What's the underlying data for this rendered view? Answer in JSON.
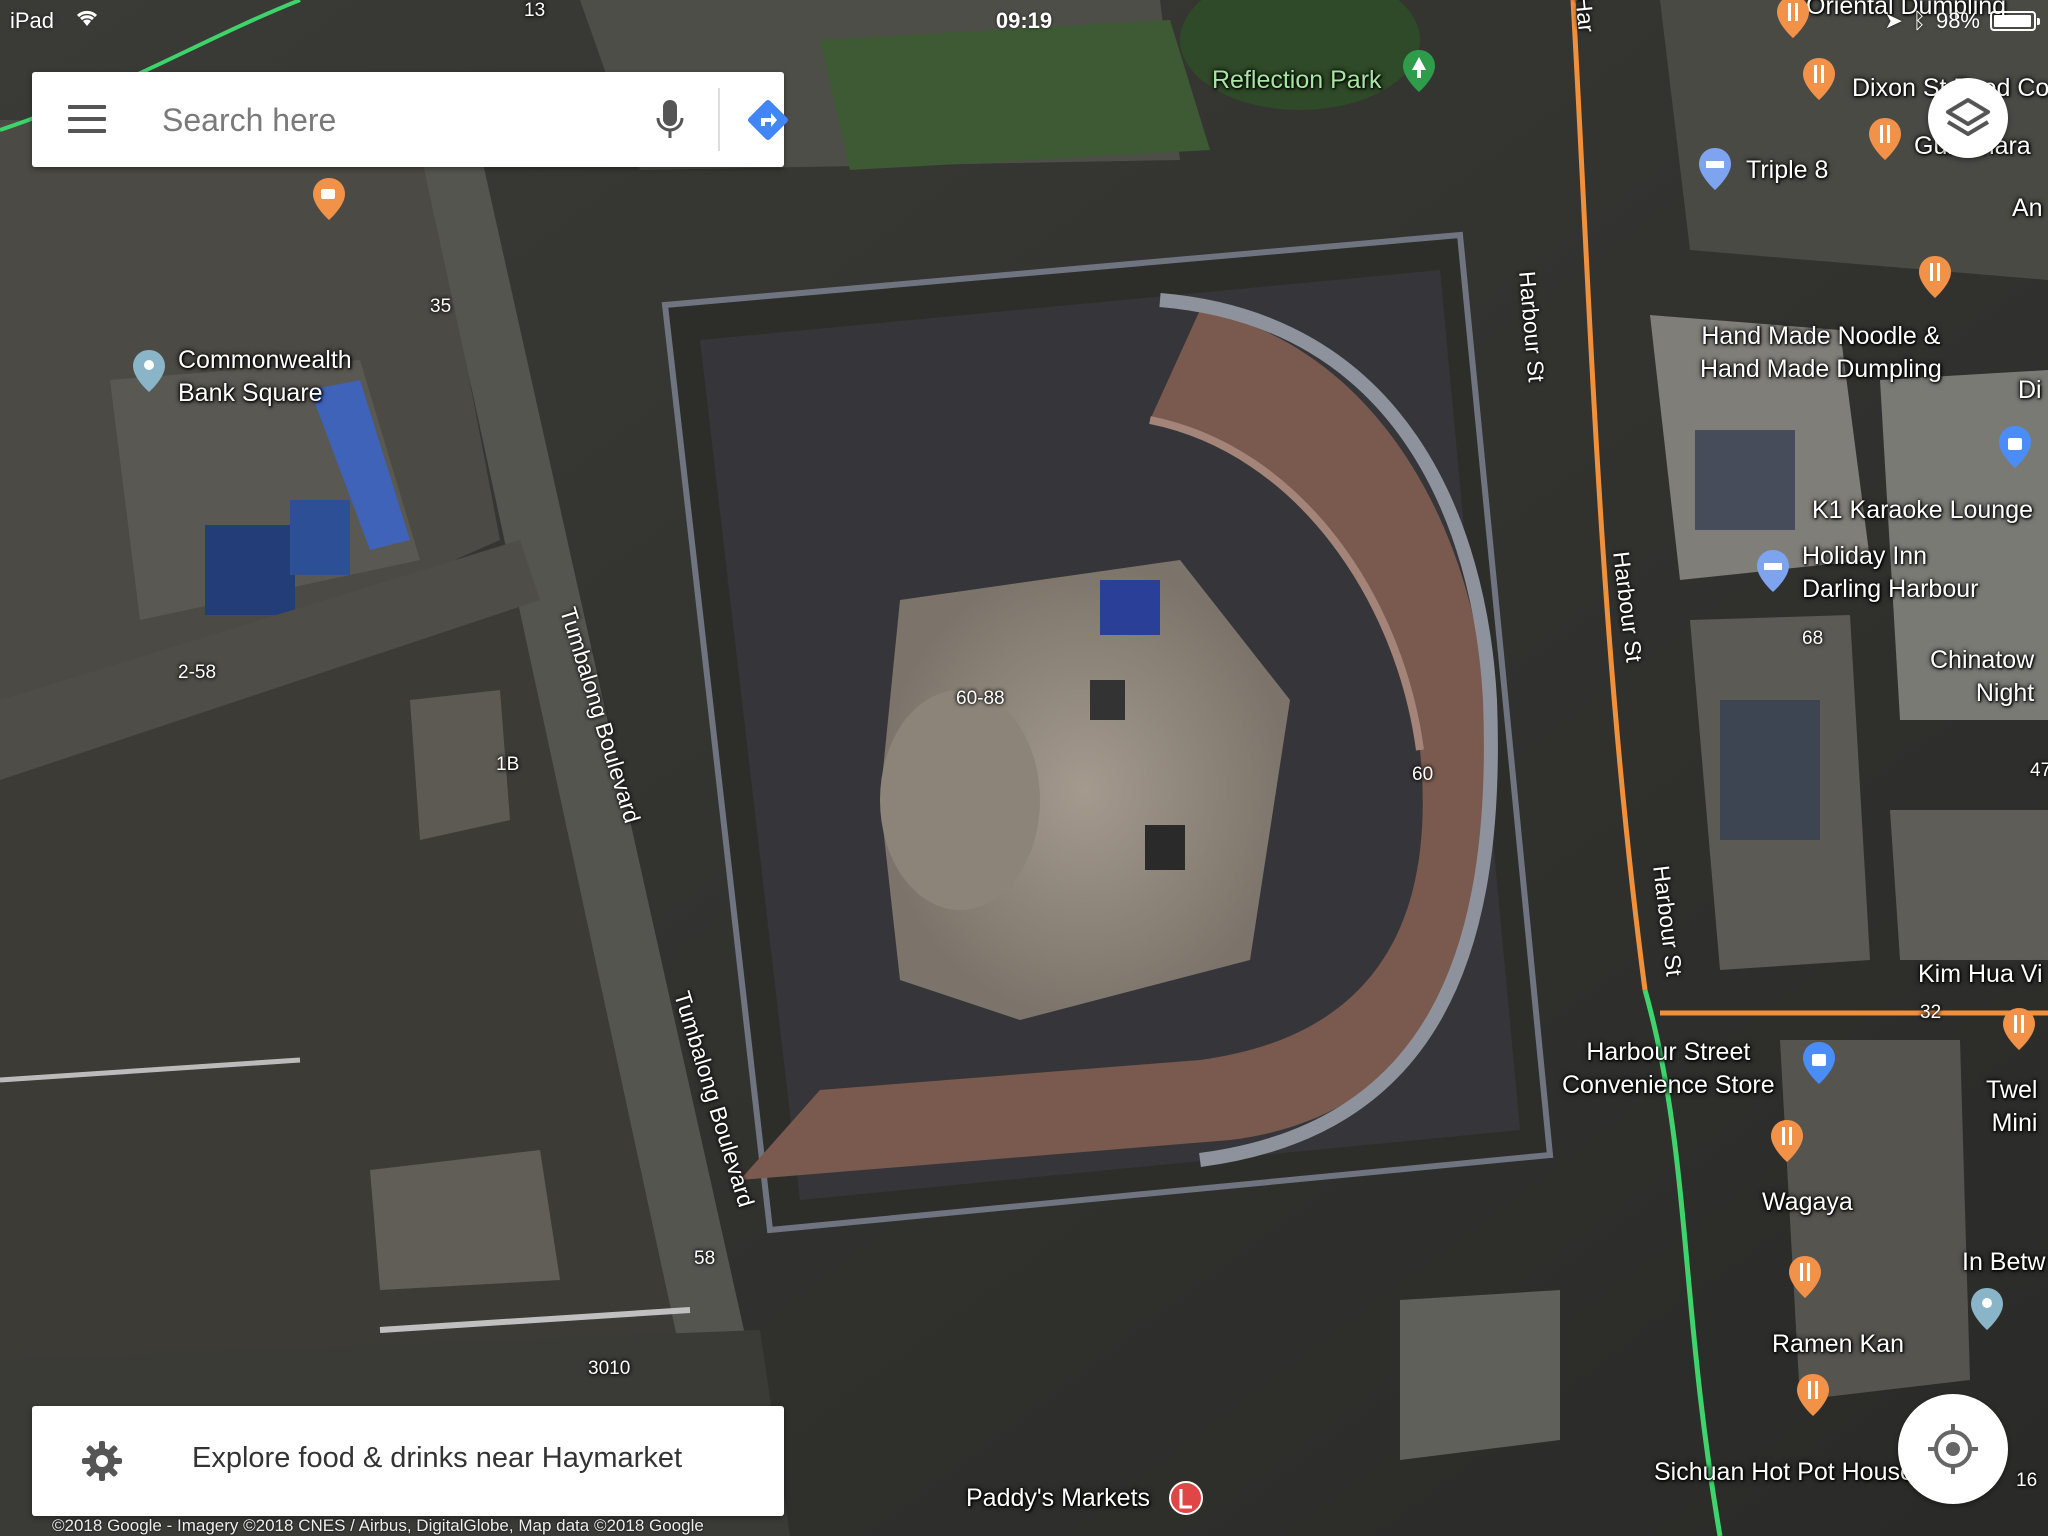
{
  "status_bar": {
    "device": "iPad",
    "time": "09:19",
    "battery": "98%",
    "battery_level": 0.98
  },
  "search": {
    "placeholder": "Search here",
    "menu_icon": "hamburger-menu-icon",
    "mic_icon": "microphone-icon",
    "directions_icon": "directions-icon"
  },
  "controls": {
    "layers_icon": "layers-icon",
    "locate_icon": "my-location-icon"
  },
  "explore": {
    "label": "Explore food & drinks near Haymarket",
    "icon": "gear-icon"
  },
  "copyright": "©2018 Google - Imagery ©2018 CNES / Airbus, DigitalGlobe, Map data ©2018 Google",
  "map": {
    "places": {
      "reflection_park": "Reflection Park",
      "oriental_dumpling": "Oriental Dumpling",
      "dixon_st_food_court": "Dixon St Food Co",
      "gumshara": "Gumshara",
      "an": "An",
      "triple_8": "Triple 8",
      "commonwealth_bank_square": "Commonwealth\nBank Square",
      "hand_made_noodle": "Hand Made Noodle &\nHand Made Dumpling",
      "di": "Di",
      "k1_karaoke": "K1 Karaoke Lounge",
      "holiday_inn": "Holiday Inn\nDarling Harbour",
      "chinatown_night": "Chinatow\nNight",
      "kim_hua_vi": "Kim Hua Vi",
      "harbour_street_convenience": "Harbour Street\nConvenience Store",
      "twelve_mini": "Twel\nMini",
      "wagaya": "Wagaya",
      "in_betw": "In Betw",
      "ramen_kan": "Ramen Kan",
      "sichuan_hot_pot": "Sichuan Hot Pot House",
      "paddys_markets": "Paddy's Markets"
    },
    "streets": {
      "harbour_st": "Harbour St",
      "tumbalong_boulevard": "Tumbalong Boulevard",
      "har": "Har"
    },
    "numbers": [
      "13",
      "35",
      "2-58",
      "1B",
      "60-88",
      "60",
      "68",
      "58",
      "3010",
      "32",
      "47",
      "16"
    ]
  },
  "colors": {
    "food_pin": "#f29249",
    "hotel_pin": "#7ea4f0",
    "shop_pin": "#4a8df6",
    "place_pin": "#8ab4c8",
    "park_pin": "#2e9c4a",
    "orange_road": "#f0903b",
    "green_line": "#3ed36b",
    "directions_blue": "#4285f4"
  }
}
